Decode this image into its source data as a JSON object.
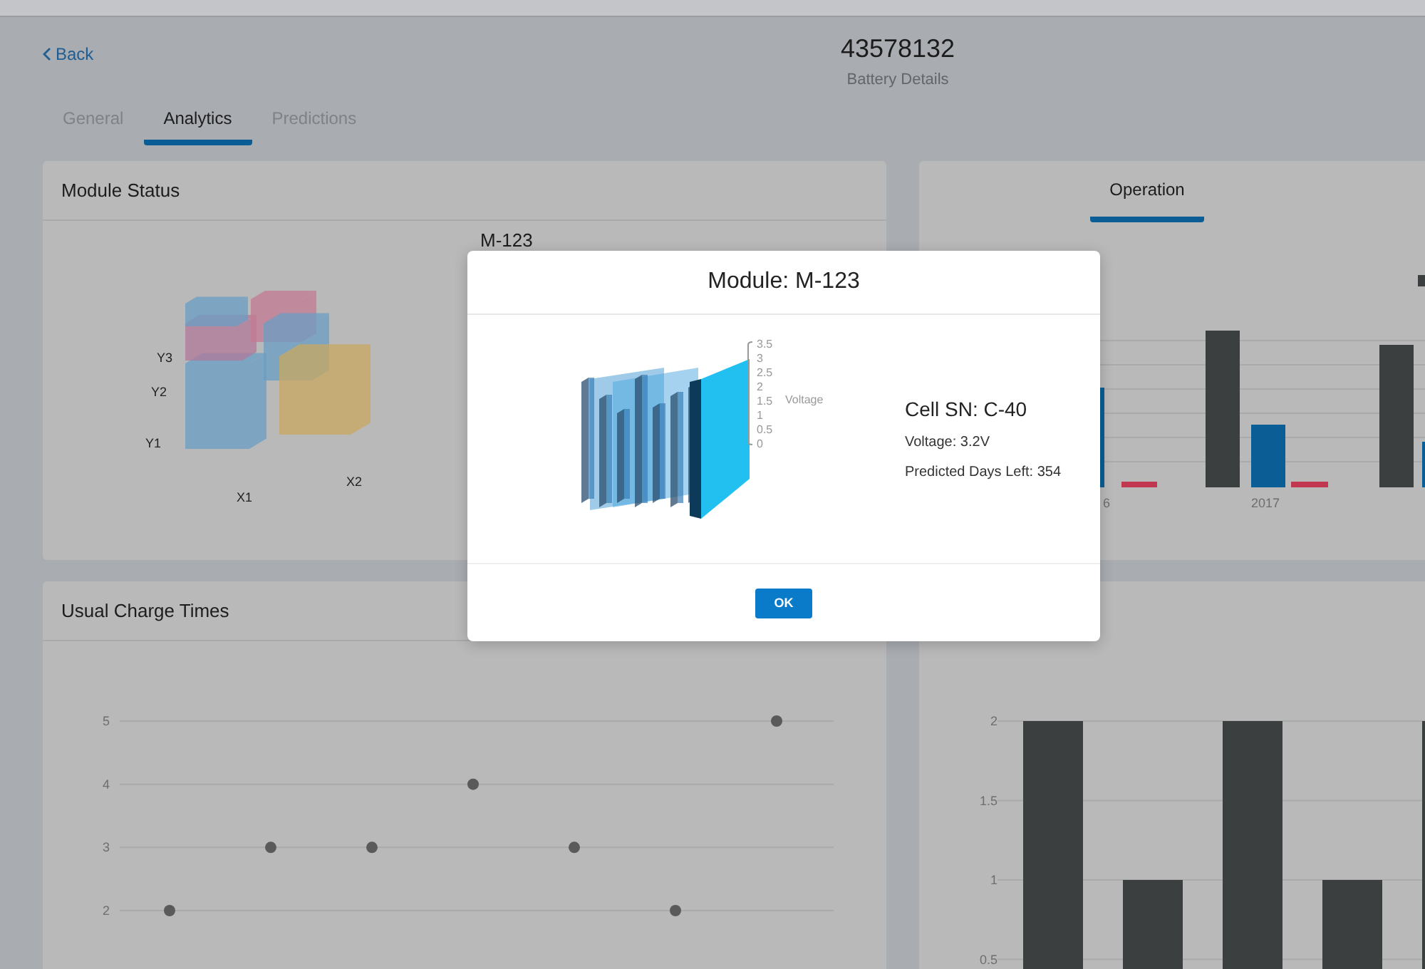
{
  "header": {
    "back": "Back",
    "title": "43578132",
    "subtitle": "Battery Details"
  },
  "tabs": [
    {
      "label": "General",
      "selected": false
    },
    {
      "label": "Analytics",
      "selected": true
    },
    {
      "label": "Predictions",
      "selected": false
    }
  ],
  "module_status": {
    "title": "Module Status",
    "module_label": "M-123",
    "y_labels": [
      "Y3",
      "Y2",
      "Y1"
    ],
    "x_labels": [
      "X1",
      "X2"
    ]
  },
  "operation": {
    "tabs": [
      {
        "label": "Operation",
        "selected": true
      }
    ],
    "x_labels": [
      "6",
      "2017"
    ]
  },
  "charge_times": {
    "title": "Usual Charge Times",
    "chart_data": {
      "type": "scatter",
      "grid": true,
      "ylim": [
        2,
        5
      ],
      "yticks": [
        2,
        3,
        4,
        5
      ],
      "values": [
        2,
        3,
        3,
        4,
        3,
        2,
        5
      ]
    }
  },
  "bottom_right": {
    "chart_data": {
      "type": "bar",
      "grid": true,
      "ylim": [
        0,
        2
      ],
      "yticks": [
        0.5,
        1,
        1.5,
        2
      ],
      "values": [
        2,
        1,
        2,
        1,
        2
      ]
    }
  },
  "dialog": {
    "title": "Module: M-123",
    "axis_ticks": [
      "3.5",
      "3",
      "2.5",
      "2",
      "1.5",
      "1",
      "0.5",
      "0"
    ],
    "axis_label": "Voltage",
    "cell_sn": "Cell SN: C-40",
    "voltage": "Voltage: 3.2V",
    "days_left": "Predicted Days Left: 354",
    "ok": "OK"
  }
}
